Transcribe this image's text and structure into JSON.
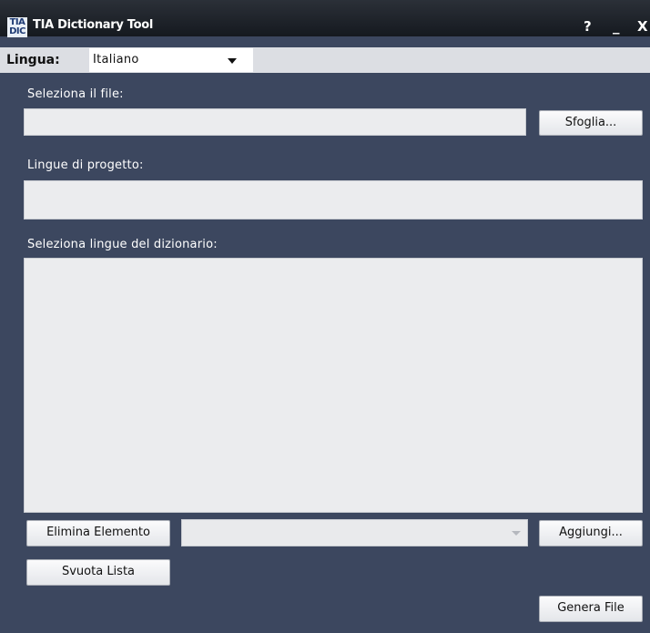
{
  "window": {
    "title": "TIA Dictionary Tool",
    "logo_text_top": "TIA",
    "logo_text_bottom": "DIC",
    "help_label": "?",
    "minimize_label": "_",
    "close_label": "X"
  },
  "language_bar": {
    "label": "Lingua:",
    "selected": "Italiano"
  },
  "file_section": {
    "label": "Seleziona il file:",
    "value": "",
    "browse_button": "Sfoglia..."
  },
  "project_languages": {
    "label": "Lingue di progetto:",
    "value": ""
  },
  "dictionary_languages": {
    "label": "Seleziona lingue del dizionario:",
    "items": []
  },
  "actions": {
    "remove_button": "Elimina Elemento",
    "add_combo_value": "",
    "add_button": "Aggiungi...",
    "clear_button": "Svuota Lista",
    "generate_button": "Genera File"
  },
  "colors": {
    "background": "#3c475f",
    "titlebar": "#1b1f26",
    "field": "#ebecee"
  }
}
